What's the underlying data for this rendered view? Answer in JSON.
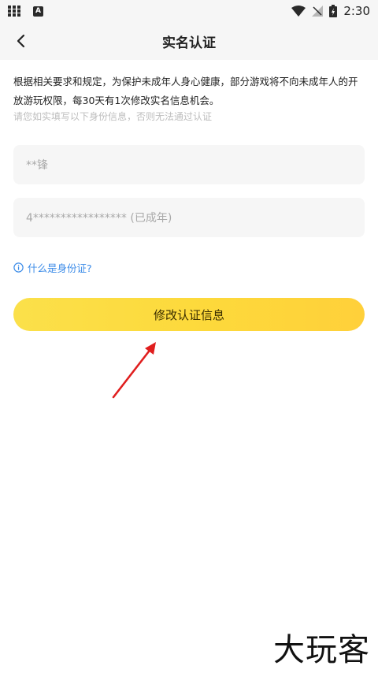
{
  "status_bar": {
    "time": "2:30",
    "icons": [
      "grid-icon",
      "a-icon",
      "wifi-icon",
      "signal-off-icon",
      "battery-charging-icon"
    ]
  },
  "header": {
    "title": "实名认证",
    "back_icon": "chevron-left-icon"
  },
  "notice": {
    "text": "根据相关要求和规定，为保护未成年人身心健康，部分游戏将不向未成年人的开放游玩权限，每30天有1次修改实名信息机会。",
    "hint": "请您如实填写以下身份信息，否则无法通过认证"
  },
  "form": {
    "name_value": "**锋",
    "id_value": "4***************** (已成年)"
  },
  "help_link": {
    "label": "什么是身份证?",
    "icon": "info-icon"
  },
  "submit": {
    "label": "修改认证信息"
  },
  "annotation": {
    "arrow_color": "#e01e1e"
  },
  "watermark": {
    "text": "大玩客"
  },
  "colors": {
    "accent": "#fdd93b",
    "link": "#3b8be8",
    "hint": "#bdbdbd",
    "field_bg": "#f6f6f6"
  }
}
